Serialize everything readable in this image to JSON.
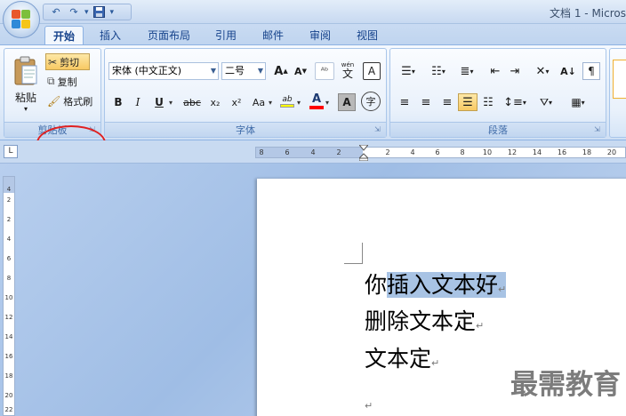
{
  "window": {
    "title": "文档 1 - Micros"
  },
  "quick_access": {
    "more_label": "▾"
  },
  "tabs": [
    {
      "label": "开始",
      "active": true
    },
    {
      "label": "插入"
    },
    {
      "label": "页面布局"
    },
    {
      "label": "引用"
    },
    {
      "label": "邮件"
    },
    {
      "label": "审阅"
    },
    {
      "label": "视图"
    }
  ],
  "clipboard": {
    "paste_label": "粘贴",
    "cut_label": "剪切",
    "copy_label": "复制",
    "format_painter_label": "格式刷",
    "group_label": "剪贴板"
  },
  "font": {
    "name_value": "宋体 (中文正文)",
    "size_value": "二号",
    "grow_label": "A",
    "shrink_label": "A",
    "clear_label": "ᴬᵇ",
    "phonetic_label": "wén",
    "phonetic_char": "文",
    "border_label": "A",
    "bold_label": "B",
    "italic_label": "I",
    "underline_label": "U",
    "strike_label": "abc",
    "subscript_label": "x₂",
    "superscript_label": "x²",
    "case_label": "Aa",
    "highlight_label": "ab",
    "color_label": "A",
    "shade_label": "A",
    "enclose_label": "字",
    "group_label": "字体"
  },
  "paragraph": {
    "group_label": "段落"
  },
  "ruler": {
    "ticks": [
      "8",
      "6",
      "4",
      "2",
      "2",
      "4",
      "6",
      "8",
      "10",
      "12",
      "14",
      "16",
      "18",
      "20"
    ],
    "corner": "L",
    "vticks": [
      "4",
      "2",
      "2",
      "4",
      "6",
      "8",
      "10",
      "12",
      "14",
      "16",
      "18",
      "20",
      "22"
    ]
  },
  "document": {
    "line1_prefix": "你",
    "line1_selected": "插入文本好",
    "line2": "删除文本定",
    "line3": "文本定",
    "para_mark": "↵"
  },
  "watermark": "最需教育",
  "colors": {
    "accent": "#15428b",
    "highlight": "#f8c963",
    "selection": "#a8c3e4",
    "annotation": "#e02020"
  }
}
